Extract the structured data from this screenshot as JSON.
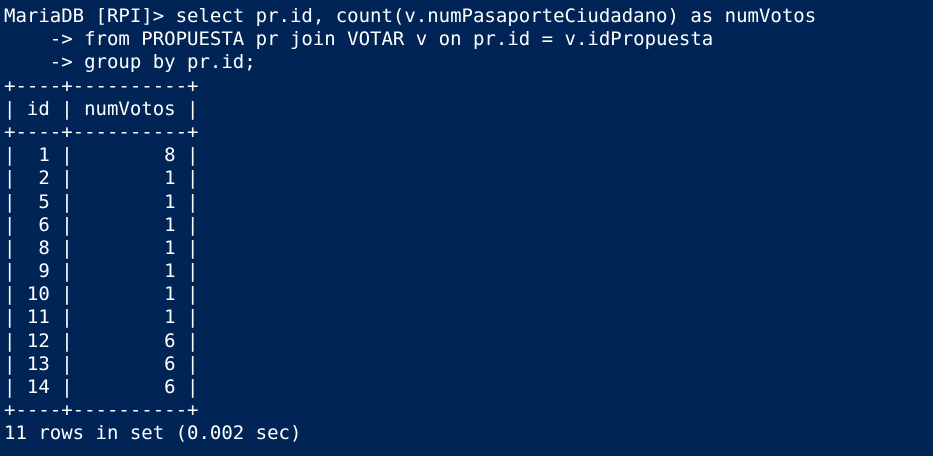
{
  "terminal": {
    "colors": {
      "background": "#012456",
      "foreground": "#ffffff"
    },
    "lines": [
      "MariaDB [RPI]> select pr.id, count(v.numPasaporteCiudadano) as numVotos",
      "    -> from PROPUESTA pr join VOTAR v on pr.id = v.idPropuesta",
      "    -> group by pr.id;",
      "+----+----------+",
      "| id | numVotos |",
      "+----+----------+",
      "|  1 |        8 |",
      "|  2 |        1 |",
      "|  5 |        1 |",
      "|  6 |        1 |",
      "|  8 |        1 |",
      "|  9 |        1 |",
      "| 10 |        1 |",
      "| 11 |        1 |",
      "| 12 |        6 |",
      "| 13 |        6 |",
      "| 14 |        6 |",
      "+----+----------+",
      "11 rows in set (0.002 sec)"
    ]
  }
}
